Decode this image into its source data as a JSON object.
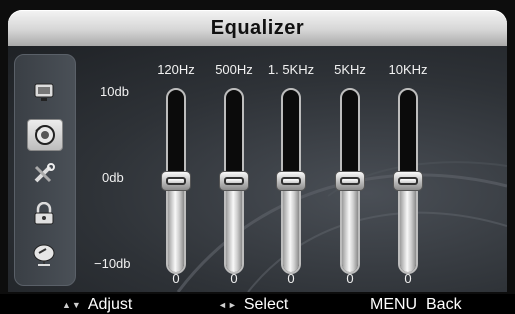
{
  "window": {
    "title": "Equalizer"
  },
  "sidebar": {
    "icons": [
      {
        "name": "picture-icon",
        "selected": false
      },
      {
        "name": "sound-icon",
        "selected": true
      },
      {
        "name": "setup-tools-icon",
        "selected": false
      },
      {
        "name": "lock-icon",
        "selected": false
      },
      {
        "name": "channel-dish-icon",
        "selected": false
      }
    ]
  },
  "scale": {
    "top": "10db",
    "mid": "0db",
    "bottom": "−10db"
  },
  "bands": [
    {
      "freq": "120Hz",
      "value": 0,
      "value_label": "0"
    },
    {
      "freq": "500Hz",
      "value": 0,
      "value_label": "0"
    },
    {
      "freq": "1. 5KHz",
      "value": 0,
      "value_label": "0"
    },
    {
      "freq": "5KHz",
      "value": 0,
      "value_label": "0"
    },
    {
      "freq": "10KHz",
      "value": 0,
      "value_label": "0"
    }
  ],
  "range": {
    "min": -10,
    "max": 10
  },
  "footer": {
    "adjust_label": "Adjust",
    "select_label": "Select",
    "back_label": "MENU  Back"
  },
  "colors": {
    "panel": "#2e3237",
    "title_bar": "#d6d6d6",
    "footer": "#000000"
  }
}
